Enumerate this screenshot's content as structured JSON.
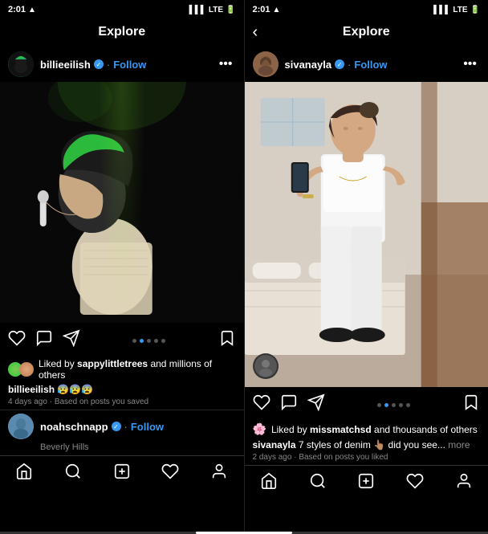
{
  "leftPanel": {
    "statusBar": {
      "time": "2:01",
      "signal": "●●●",
      "carrier": "LTE",
      "battery": "▮▮▮"
    },
    "nav": {
      "title": "Explore",
      "backIcon": "‹"
    },
    "post": {
      "username": "billieeilish",
      "verified": true,
      "followLabel": "Follow",
      "moreDots": "•••",
      "likesText1": "Liked by",
      "likedBy": "sappylittletrees",
      "likesText2": "and millions of others",
      "captionUsername": "billieeilish",
      "captionEmojis": "😰😰😰",
      "timestamp": "4 days ago · Based on posts you saved",
      "dotsCount": 5,
      "activesDot": 2
    },
    "nextUser": {
      "username": "noahschnapp",
      "verified": true,
      "followLabel": "Follow",
      "location": "Beverly Hills"
    },
    "bottomNav": {
      "icons": [
        "home",
        "search",
        "add",
        "heart",
        "profile"
      ]
    }
  },
  "rightPanel": {
    "statusBar": {
      "time": "2:01",
      "signal": "●●●",
      "carrier": "LTE",
      "battery": "▮▮▮"
    },
    "nav": {
      "title": "Explore",
      "backIcon": "‹"
    },
    "post": {
      "username": "sivanayla",
      "verified": true,
      "followLabel": "Follow",
      "moreDots": "•••",
      "likesEmojiColor": "🌸",
      "likesText1": "Liked by",
      "likedBy": "missmatchsd",
      "likesText2": "and thousands of others",
      "captionUsername": "sivanayla",
      "captionText": "7 styles of denim 👆🏽 did you see...",
      "captionMore": "more",
      "timestamp": "2 days ago · Based on posts you liked",
      "dotsCount": 5,
      "activeDot": 2
    },
    "bottomNav": {
      "icons": [
        "home",
        "search",
        "add",
        "heart",
        "profile"
      ]
    }
  }
}
